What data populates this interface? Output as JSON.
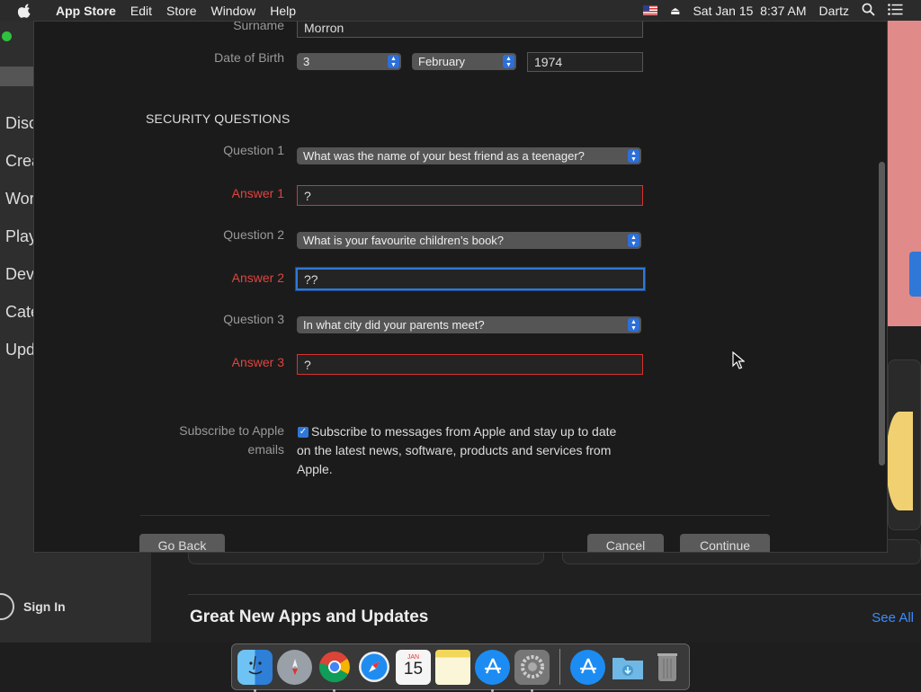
{
  "menubar": {
    "app_name": "App Store",
    "items": [
      "Edit",
      "Store",
      "Window",
      "Help"
    ],
    "datetime": "Sat Jan 15  8:37 AM",
    "user": "Dartz"
  },
  "sidebar": {
    "items": [
      "Disc",
      "Crea",
      "Wor",
      "Play",
      "Dev",
      "Cate",
      "Upd"
    ],
    "sign_in": "Sign In"
  },
  "main": {
    "section_title": "Great New Apps and Updates",
    "see_all": "See All"
  },
  "form": {
    "surname_label": "Surname",
    "surname_value": "Morron",
    "dob_label": "Date of Birth",
    "dob_day": "3",
    "dob_month": "February",
    "dob_year": "1974",
    "security_heading": "SECURITY QUESTIONS",
    "question1_label": "Question 1",
    "question1_value": "What was the name of your best friend as a teenager?",
    "answer1_label": "Answer 1",
    "answer1_value": "?",
    "question2_label": "Question 2",
    "question2_value": "What is your favourite children’s book?",
    "answer2_label": "Answer 2",
    "answer2_value": "??",
    "question3_label": "Question 3",
    "question3_value": "In what city did your parents meet?",
    "answer3_label": "Answer 3",
    "answer3_value": "?",
    "subscribe_label_line1": "Subscribe to Apple",
    "subscribe_label_line2": "emails",
    "subscribe_checked": true,
    "subscribe_text_line1": "Subscribe to messages from Apple and stay up to date",
    "subscribe_text_line2": "on the latest news, software, products and services from",
    "subscribe_text_line3": "Apple."
  },
  "buttons": {
    "go_back": "Go Back",
    "cancel": "Cancel",
    "continue": "Continue"
  },
  "dock": {
    "calendar_month": "JAN",
    "calendar_day": "15",
    "icons": [
      "finder-icon",
      "launchpad-icon",
      "chrome-icon",
      "safari-icon",
      "calendar-icon",
      "notes-icon",
      "app-store-icon",
      "system-preferences-icon",
      "app-store-icon-2",
      "downloads-folder-icon",
      "trash-icon"
    ]
  },
  "colors": {
    "error": "#e0443f",
    "accent": "#2f78d8",
    "link": "#3b8cff"
  }
}
